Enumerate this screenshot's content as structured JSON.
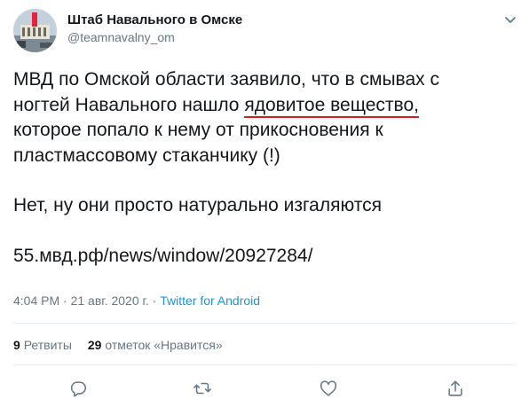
{
  "author": {
    "display_name": "Штаб Навального в Омске",
    "handle": "@teamnavalny_om",
    "avatar": "avatar-photo"
  },
  "tweet": {
    "line1": "МВД по Омской области заявило, что  в смывах с",
    "line2_before": "ногтей Навального нашло ",
    "line2_highlight": "ядовитое вещество,",
    "line3": "которое попало к нему от прикосновения к",
    "line4": "пластмассовому стаканчику (!)",
    "line5": "Нет, ну они просто натурально изгаляются",
    "link": "55.мвд.рф/news/window/20927284/"
  },
  "meta": {
    "time": "4:04 PM",
    "separator": " · ",
    "date": "21 авг. 2020 г.",
    "source": "Twitter for Android"
  },
  "stats": {
    "retweets_count": "9",
    "retweets_label": "Ретвиты",
    "likes_count": "29",
    "likes_label": "отметок «Нравится»"
  },
  "actions": {
    "reply_icon": "reply-icon",
    "retweet_icon": "retweet-icon",
    "like_icon": "like-icon",
    "share_icon": "share-icon"
  },
  "colors": {
    "text": "#14171a",
    "muted": "#657786",
    "link": "#1b95e0",
    "highlight_underline": "#d81e1e",
    "divider": "#e6ecf0"
  }
}
